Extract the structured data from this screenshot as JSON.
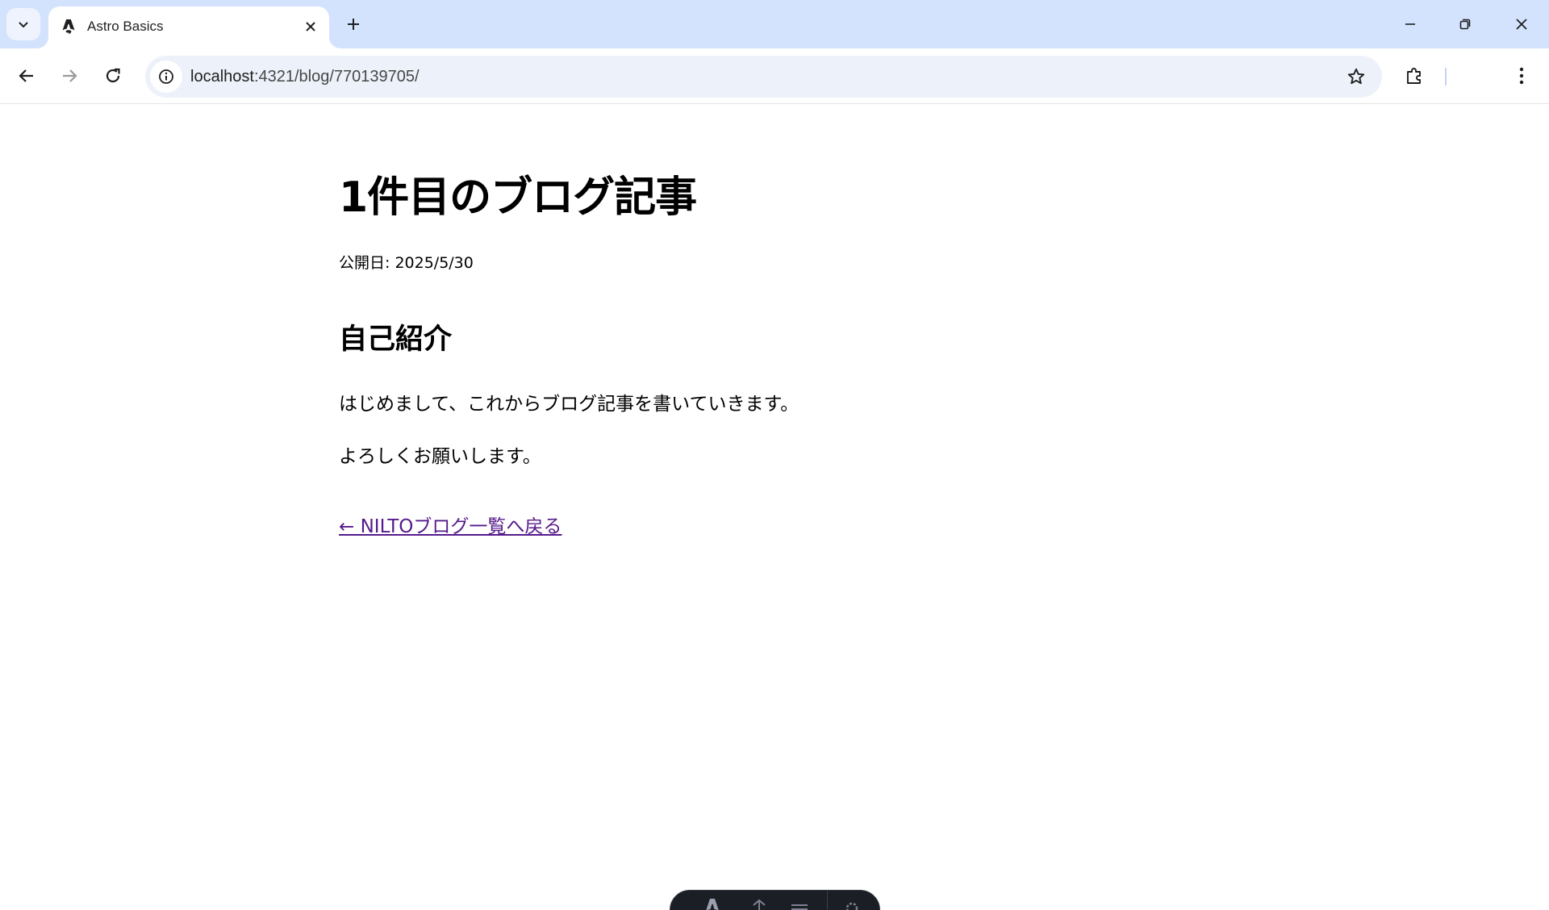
{
  "browser": {
    "tab": {
      "title": "Astro Basics"
    },
    "address_bar": {
      "host": "localhost",
      "path": ":4321/blog/770139705/"
    }
  },
  "article": {
    "title": "1件目のブログ記事",
    "published": "公開日: 2025/5/30",
    "section_heading": "自己紹介",
    "paragraphs": [
      "はじめまして、これからブログ記事を書いていきます。",
      "よろしくお願いします。"
    ],
    "back_link": "← NILTOブログ一覧へ戻る"
  },
  "colors": {
    "tabstrip": "#d3e3fd",
    "omnibox": "#edf2fa",
    "visited_link": "#551a8b",
    "dev_toolbar": "#1c1e26"
  },
  "icons": {
    "tab_search": "chevron-down-icon",
    "favicon": "astro-logo-icon",
    "tab_close": "close-icon",
    "new_tab": "plus-icon",
    "minimize": "minimize-icon",
    "restore": "restore-icon",
    "window_close": "close-icon",
    "back": "arrow-left-icon",
    "forward": "arrow-right-icon",
    "reload": "reload-icon",
    "site_info": "info-icon",
    "bookmark": "star-icon",
    "extensions": "puzzle-icon",
    "menu": "kebab-menu-icon"
  }
}
